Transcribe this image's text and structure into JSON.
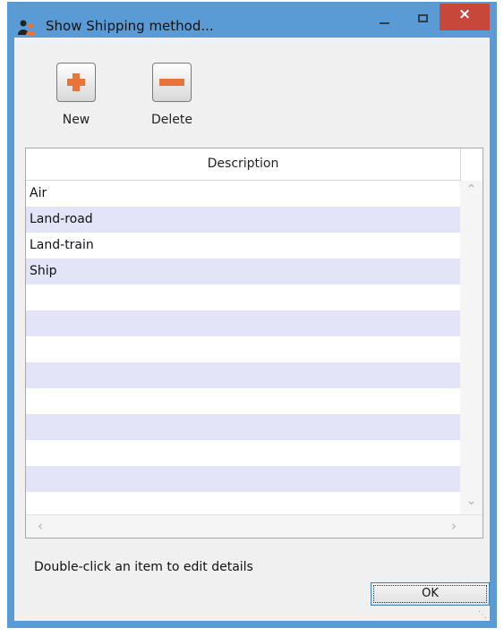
{
  "window": {
    "title": "Show Shipping method...",
    "icon": "app-people-icon",
    "controls": {
      "minimize": "minimize-icon",
      "maximize": "maximize-icon",
      "close": "×"
    }
  },
  "toolbar": {
    "new_label": "New",
    "delete_label": "Delete",
    "new_icon": "plus-icon",
    "delete_icon": "minus-icon"
  },
  "table": {
    "column_header": "Description",
    "rows": [
      "Air",
      "Land-road",
      "Land-train",
      "Ship",
      "",
      "",
      "",
      "",
      "",
      "",
      "",
      ""
    ]
  },
  "footer": {
    "hint": "Double-click an item to edit details",
    "ok_label": "OK"
  },
  "colors": {
    "titlebar": "#5b9bd5",
    "close": "#c7483a",
    "row_alt": "#e3e4f7",
    "accent_icon": "#e8743b"
  }
}
